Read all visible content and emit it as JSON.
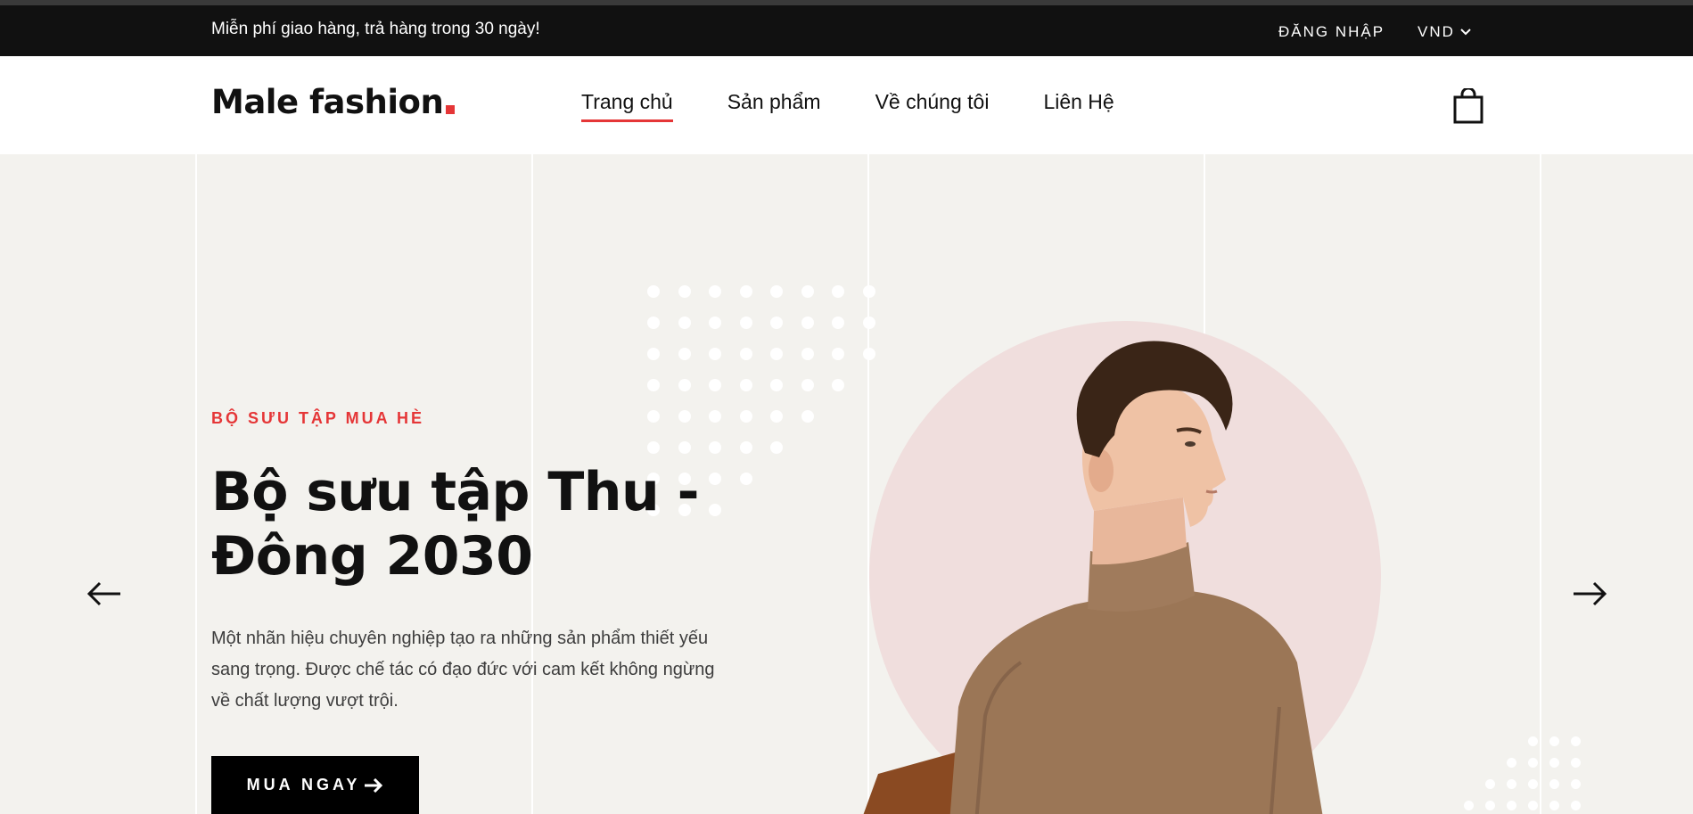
{
  "topbar": {
    "promo_text": "Miễn phí giao hàng, trả hàng trong 30 ngày!",
    "login_label": "ĐĂNG NHẬP",
    "currency_label": "VND"
  },
  "header": {
    "logo_text": "Male fashion",
    "nav": [
      {
        "label": "Trang chủ",
        "active": true
      },
      {
        "label": "Sản phẩm",
        "active": false
      },
      {
        "label": "Về chúng tôi",
        "active": false
      },
      {
        "label": "Liên Hệ",
        "active": false
      }
    ],
    "cart_icon": "shopping-bag-icon"
  },
  "hero": {
    "eyebrow": "BỘ SƯU TẬP MUA HÈ",
    "headline_line1": "Bộ sưu tập Thu -",
    "headline_line2": "Đông 2030",
    "description": "Một nhãn hiệu chuyên nghiệp tạo ra những sản phẩm thiết yếu sang trọng. Được chế tác có đạo đức với cam kết không ngừng về chất lượng vượt trội.",
    "cta_label": "MUA NGAY",
    "prev_icon": "arrow-left-icon",
    "next_icon": "arrow-right-icon"
  },
  "colors": {
    "accent": "#e53637",
    "topbar_bg": "#111111",
    "hero_bg": "#f3f2ee",
    "circle_bg": "#f0dedd",
    "sweater": "#9b7656"
  }
}
